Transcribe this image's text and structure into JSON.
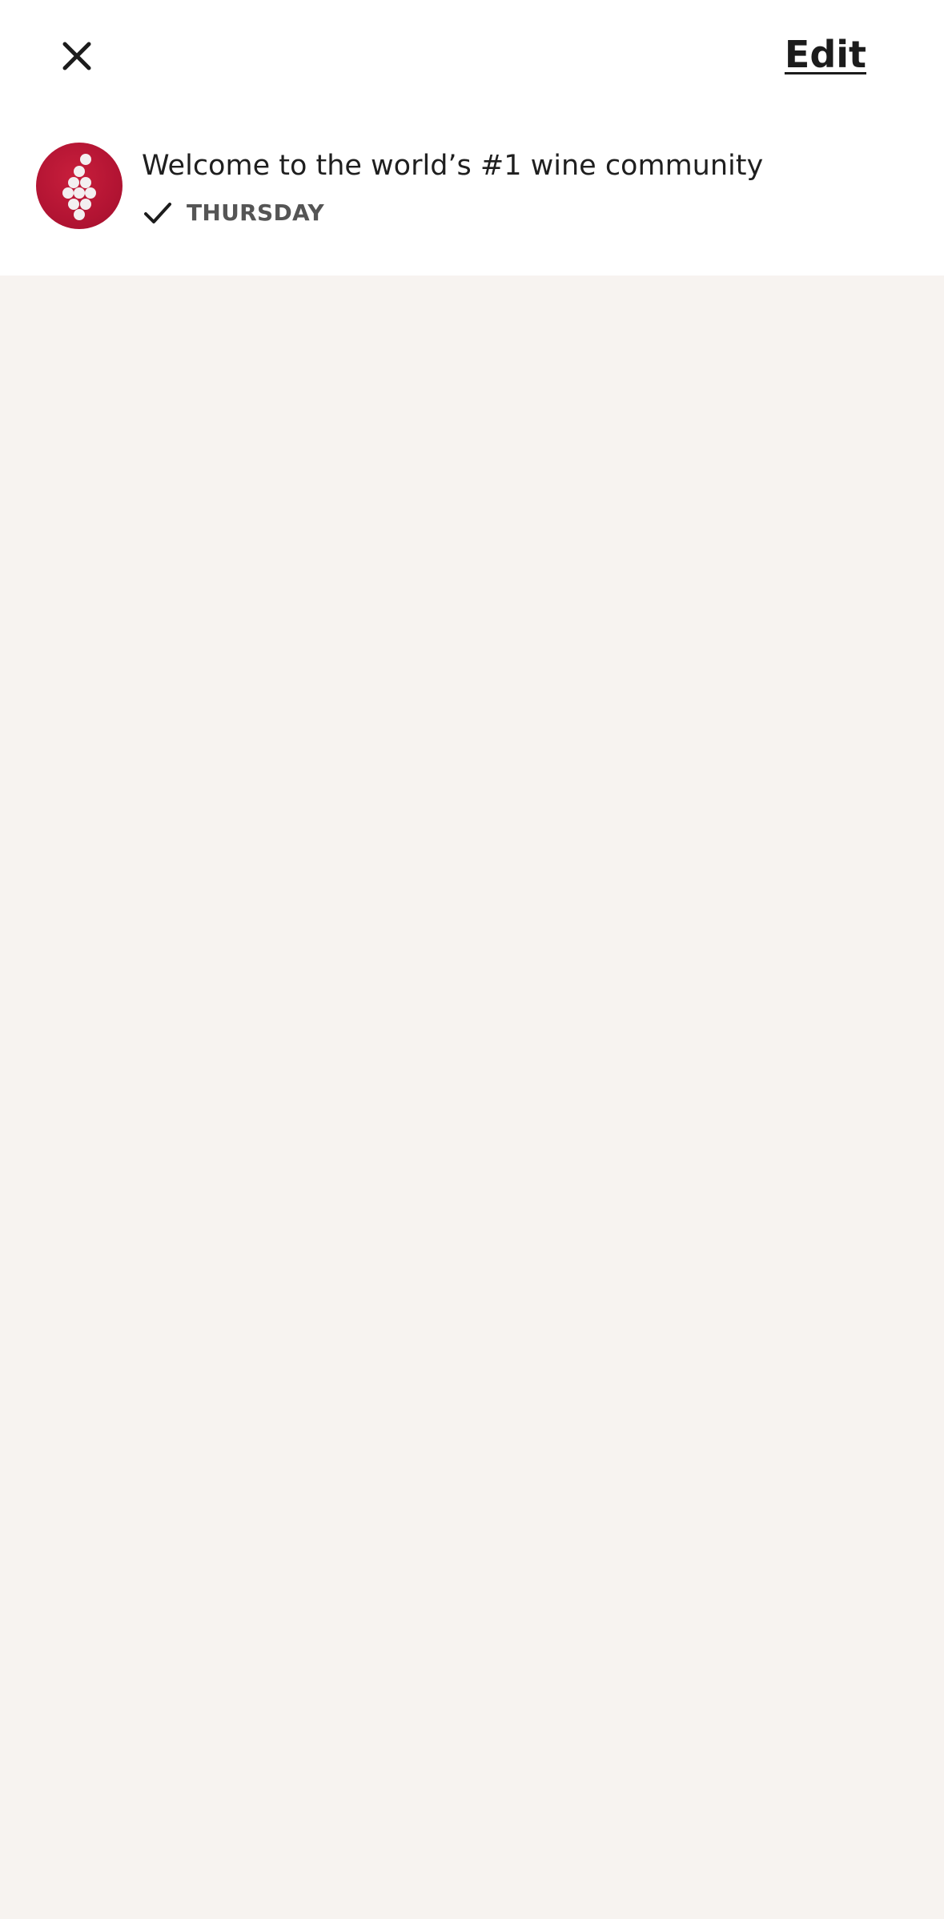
{
  "header": {
    "close_icon": "close-icon",
    "edit_label": "Edit"
  },
  "messages": [
    {
      "avatar_icon": "grape-cluster-logo-icon",
      "title": "Welcome to the world’s #1 wine community",
      "status_icon": "checkmark-icon",
      "date": "THURSDAY"
    }
  ],
  "colors": {
    "header_background": "#ffffff",
    "page_background": "#f7f3f0",
    "brand_red": "#b31433",
    "text_primary": "#1c1c1c",
    "text_secondary": "#555555"
  }
}
